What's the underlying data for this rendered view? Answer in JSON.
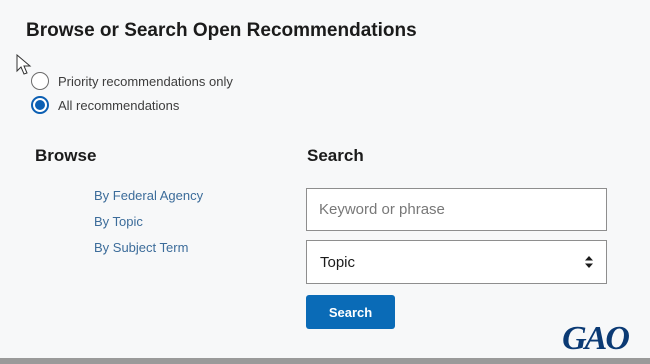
{
  "title": "Browse or Search Open Recommendations",
  "filter": {
    "options": [
      {
        "label": "Priority recommendations only",
        "checked": false
      },
      {
        "label": "All recommendations",
        "checked": true
      }
    ]
  },
  "browse": {
    "heading": "Browse",
    "links": [
      "By Federal Agency",
      "By Topic",
      "By Subject Term"
    ]
  },
  "search": {
    "heading": "Search",
    "keyword_placeholder": "Keyword or phrase",
    "keyword_value": "",
    "topic_selected": "Topic",
    "button_label": "Search"
  },
  "logo": {
    "text": "GAO"
  },
  "colors": {
    "accent": "#0a6bb7",
    "link": "#3c6c9a",
    "logo": "#0b3a74",
    "background": "#f7f8f9"
  },
  "icons": [
    "mouse-cursor-icon",
    "select-arrows-icon",
    "gao-logo"
  ]
}
